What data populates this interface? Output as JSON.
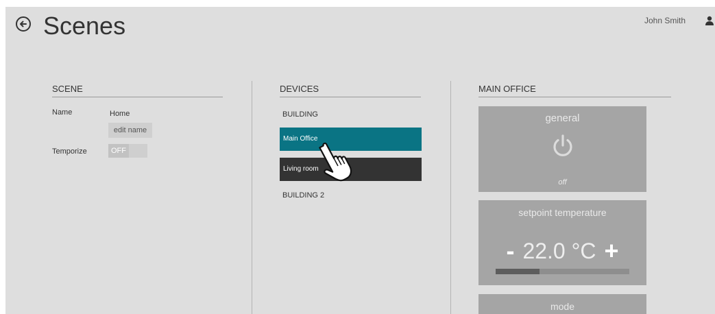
{
  "header": {
    "title": "Scenes",
    "user_name": "John Smith"
  },
  "scene": {
    "heading": "SCENE",
    "name_label": "Name",
    "name_value": "Home",
    "edit_name_label": "edit name",
    "temporize_label": "Temporize",
    "temporize_value": "OFF"
  },
  "devices": {
    "heading": "DEVICES",
    "groups": [
      {
        "label": "BUILDING",
        "items": [
          {
            "label": "Main Office",
            "selected": true
          },
          {
            "label": "Living room",
            "selected": false
          }
        ]
      },
      {
        "label": "BUILDING 2",
        "items": []
      }
    ]
  },
  "room": {
    "heading": "MAIN OFFICE",
    "general": {
      "title": "general",
      "state": "off"
    },
    "setpoint": {
      "title": "setpoint temperature",
      "minus": "-",
      "value": "22.0 °C",
      "plus": "+",
      "level": 0.33
    },
    "mode": {
      "title": "mode"
    }
  },
  "colors": {
    "background": "#dedede",
    "accent": "#0a7484",
    "dark_item": "#333333",
    "card": "#a5a5a5"
  },
  "icons": [
    "back-arrow-icon",
    "user-icon",
    "power-icon",
    "hand-pointer-icon"
  ]
}
